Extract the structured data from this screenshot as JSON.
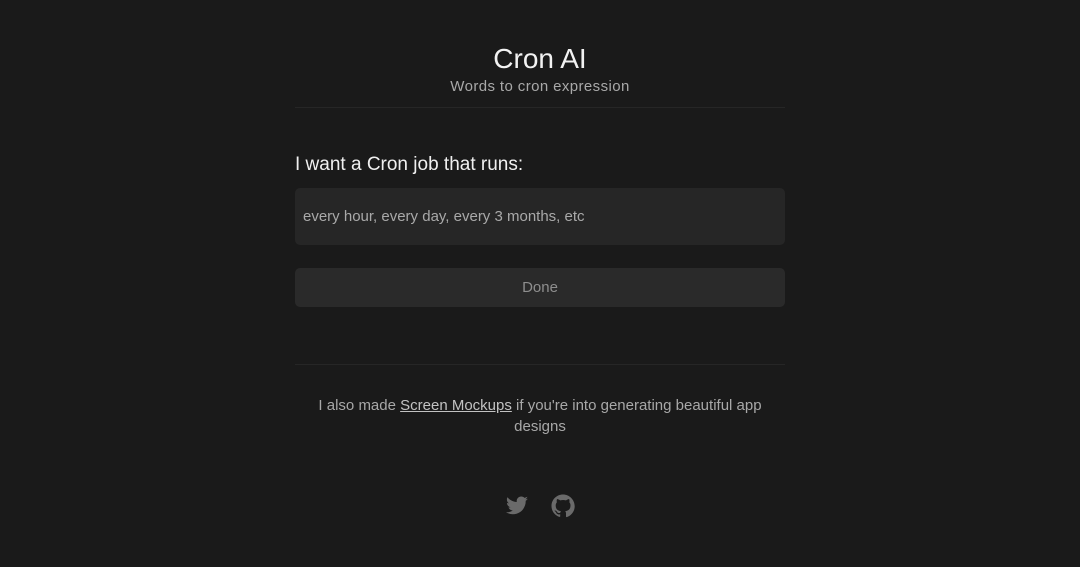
{
  "header": {
    "title": "Cron AI",
    "subtitle": "Words to cron expression"
  },
  "form": {
    "prompt_label": "I want a Cron job that runs:",
    "input_value": "",
    "input_placeholder": "every hour, every day, every 3 months, etc",
    "submit_label": "Done"
  },
  "footer": {
    "note_prefix": "I also made ",
    "note_link": "Screen Mockups",
    "note_suffix": " if you're into generating beautiful app designs",
    "social": [
      {
        "icon": "twitter-icon"
      },
      {
        "icon": "github-icon"
      }
    ]
  },
  "colors": {
    "background": "#1a1a1a",
    "input_bg": "#262626",
    "button_bg": "#2a2a2a",
    "icon": "#6a6a6a"
  }
}
